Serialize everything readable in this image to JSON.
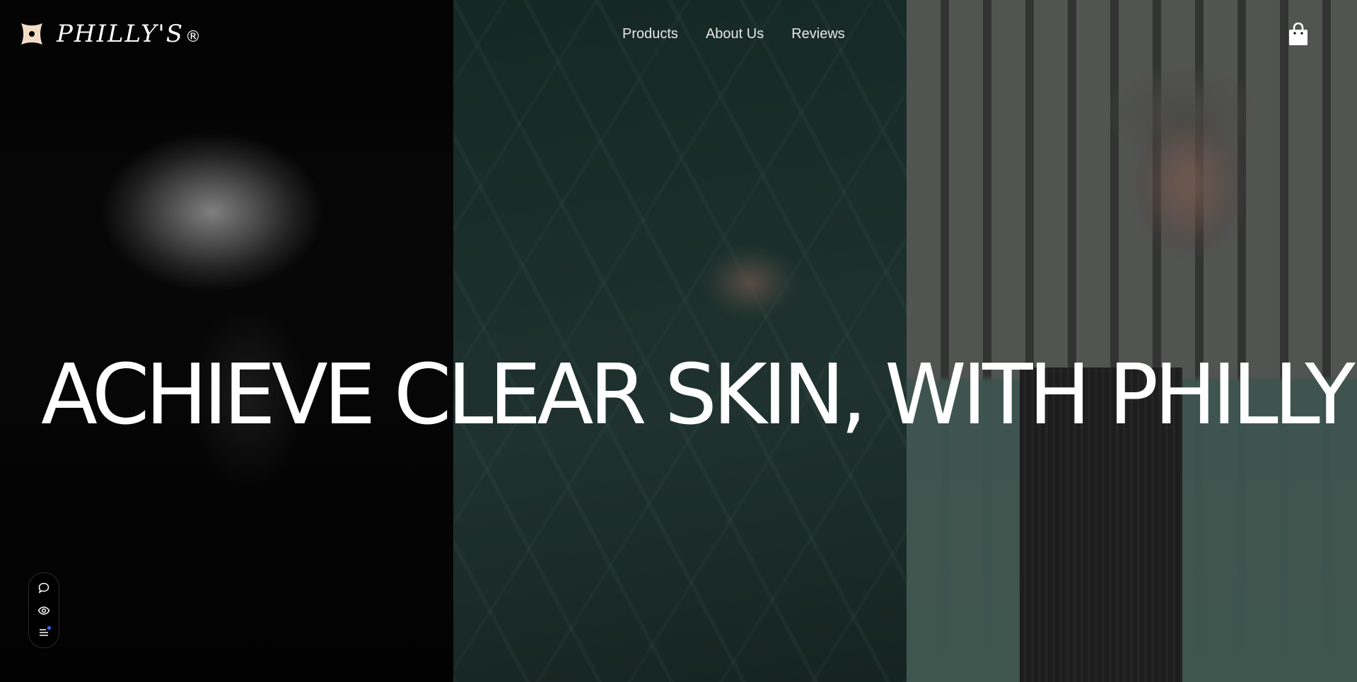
{
  "brand": {
    "name": "PHILLY'S",
    "registered_mark": "®",
    "logo_icon": "flower-petals-icon",
    "logo_color": "#f3dcc6"
  },
  "nav": {
    "items": [
      {
        "label": "Products"
      },
      {
        "label": "About Us"
      },
      {
        "label": "Reviews"
      }
    ],
    "cart_icon": "shopping-bag-icon"
  },
  "hero": {
    "headline": "ACHIEVE CLEAR SKIN, WITH PHILLY'S.",
    "panels": [
      {
        "name": "black-and-white-portrait"
      },
      {
        "name": "face-behind-leaf"
      },
      {
        "name": "woman-in-beanie"
      }
    ]
  },
  "toolbar": {
    "items": [
      {
        "icon": "comment-icon"
      },
      {
        "icon": "eye-icon"
      },
      {
        "icon": "menu-list-icon"
      }
    ],
    "accent": "#3b6cff"
  }
}
